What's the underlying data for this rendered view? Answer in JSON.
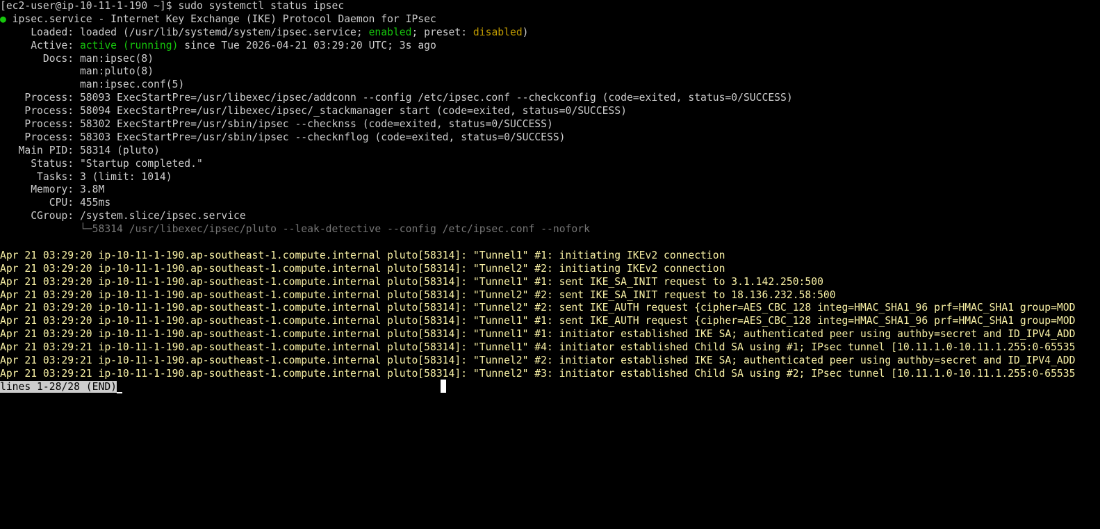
{
  "prompt": {
    "text": "[ec2-user@ip-10-11-1-190 ~]$ ",
    "command": "sudo systemctl status ipsec"
  },
  "service": {
    "bullet": "●",
    "title": " ipsec.service - Internet Key Exchange (IKE) Protocol Daemon for IPsec",
    "loaded_label": "     Loaded: ",
    "loaded_pre": "loaded (/usr/lib/systemd/system/ipsec.service; ",
    "loaded_enabled": "enabled",
    "loaded_mid": "; preset: ",
    "loaded_preset": "disabled",
    "loaded_post": ")",
    "active_label": "     Active: ",
    "active_state": "active (running)",
    "active_since": " since Tue 2026-04-21 03:29:20 UTC; 3s ago",
    "docs_label": "       Docs: ",
    "docs": [
      "man:ipsec(8)",
      "man:pluto(8)",
      "man:ipsec.conf(5)"
    ],
    "docs_indent": "             ",
    "processes": [
      "    Process: 58093 ExecStartPre=/usr/libexec/ipsec/addconn --config /etc/ipsec.conf --checkconfig (code=exited, status=0/SUCCESS)",
      "    Process: 58094 ExecStartPre=/usr/libexec/ipsec/_stackmanager start (code=exited, status=0/SUCCESS)",
      "    Process: 58302 ExecStartPre=/usr/sbin/ipsec --checknss (code=exited, status=0/SUCCESS)",
      "    Process: 58303 ExecStartPre=/usr/sbin/ipsec --checknflog (code=exited, status=0/SUCCESS)"
    ],
    "main_pid": "   Main PID: 58314 (pluto)",
    "status": "     Status: \"Startup completed.\"",
    "tasks": "      Tasks: 3 (limit: 1014)",
    "memory": "     Memory: 3.8M",
    "cpu": "        CPU: 455ms",
    "cgroup": "     CGroup: /system.slice/ipsec.service",
    "cgroup_tree_indent": "             ",
    "cgroup_tree": "└─58314 /usr/libexec/ipsec/pluto --leak-detective --config /etc/ipsec.conf --nofork"
  },
  "log_lines": [
    "Apr 21 03:29:20 ip-10-11-1-190.ap-southeast-1.compute.internal pluto[58314]: \"Tunnel1\" #1: initiating IKEv2 connection",
    "Apr 21 03:29:20 ip-10-11-1-190.ap-southeast-1.compute.internal pluto[58314]: \"Tunnel2\" #2: initiating IKEv2 connection",
    "Apr 21 03:29:20 ip-10-11-1-190.ap-southeast-1.compute.internal pluto[58314]: \"Tunnel1\" #1: sent IKE_SA_INIT request to 3.1.142.250:500",
    "Apr 21 03:29:20 ip-10-11-1-190.ap-southeast-1.compute.internal pluto[58314]: \"Tunnel2\" #2: sent IKE_SA_INIT request to 18.136.232.58:500",
    "Apr 21 03:29:20 ip-10-11-1-190.ap-southeast-1.compute.internal pluto[58314]: \"Tunnel2\" #2: sent IKE_AUTH request {cipher=AES_CBC_128 integ=HMAC_SHA1_96 prf=HMAC_SHA1 group=MOD",
    "Apr 21 03:29:20 ip-10-11-1-190.ap-southeast-1.compute.internal pluto[58314]: \"Tunnel1\" #1: sent IKE_AUTH request {cipher=AES_CBC_128 integ=HMAC_SHA1_96 prf=HMAC_SHA1 group=MOD",
    "Apr 21 03:29:20 ip-10-11-1-190.ap-southeast-1.compute.internal pluto[58314]: \"Tunnel1\" #1: initiator established IKE SA; authenticated peer using authby=secret and ID_IPV4_ADD",
    "Apr 21 03:29:21 ip-10-11-1-190.ap-southeast-1.compute.internal pluto[58314]: \"Tunnel1\" #4: initiator established Child SA using #1; IPsec tunnel [10.11.1.0-10.11.1.255:0-65535",
    "Apr 21 03:29:21 ip-10-11-1-190.ap-southeast-1.compute.internal pluto[58314]: \"Tunnel2\" #2: initiator established IKE SA; authenticated peer using authby=secret and ID_IPV4_ADD",
    "Apr 21 03:29:21 ip-10-11-1-190.ap-southeast-1.compute.internal pluto[58314]: \"Tunnel2\" #3: initiator established Child SA using #2; IPsec tunnel [10.11.1.0-10.11.1.255:0-65535"
  ],
  "pager_status": "lines 1-28/28 (END)",
  "colors": {
    "background": "#000000",
    "foreground": "#cccccc",
    "green": "#16c60c",
    "yellow": "#c19c00",
    "log_text": "#f9f1a5",
    "dim": "#767676"
  }
}
